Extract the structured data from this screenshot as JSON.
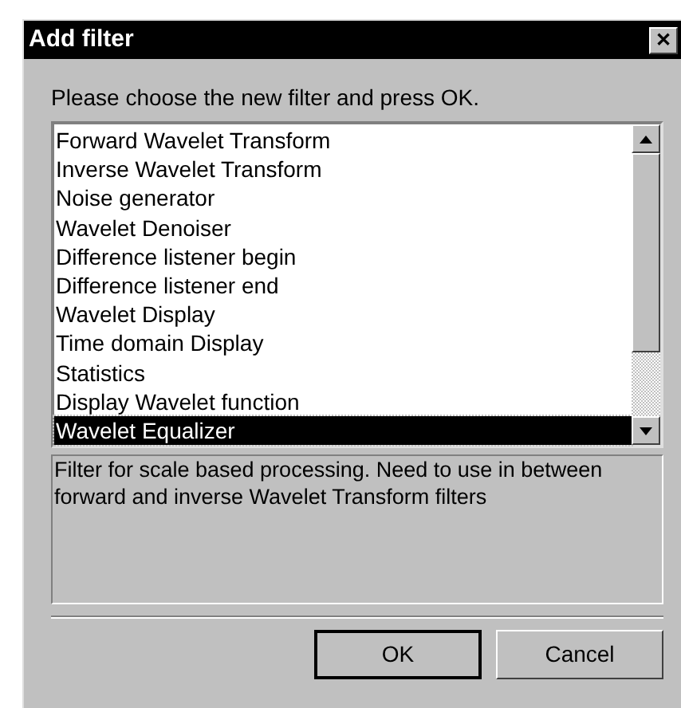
{
  "window": {
    "title": "Add filter",
    "close": "✕"
  },
  "prompt": "Please choose the new filter and press OK.",
  "filters": [
    {
      "label": "Forward Wavelet Transform",
      "selected": false
    },
    {
      "label": "Inverse Wavelet Transform",
      "selected": false
    },
    {
      "label": "Noise generator",
      "selected": false
    },
    {
      "label": "Wavelet Denoiser",
      "selected": false
    },
    {
      "label": "Difference listener begin",
      "selected": false
    },
    {
      "label": "Difference listener end",
      "selected": false
    },
    {
      "label": "Wavelet Display",
      "selected": false
    },
    {
      "label": "Time domain Display",
      "selected": false
    },
    {
      "label": "Statistics",
      "selected": false
    },
    {
      "label": "Display Wavelet function",
      "selected": false
    },
    {
      "label": "Wavelet Equalizer",
      "selected": true
    }
  ],
  "description": "Filter for scale based processing. Need to use in between forward and inverse Wavelet Transform filters",
  "buttons": [
    {
      "label": "OK",
      "default": true
    },
    {
      "label": "Cancel",
      "default": false
    }
  ]
}
